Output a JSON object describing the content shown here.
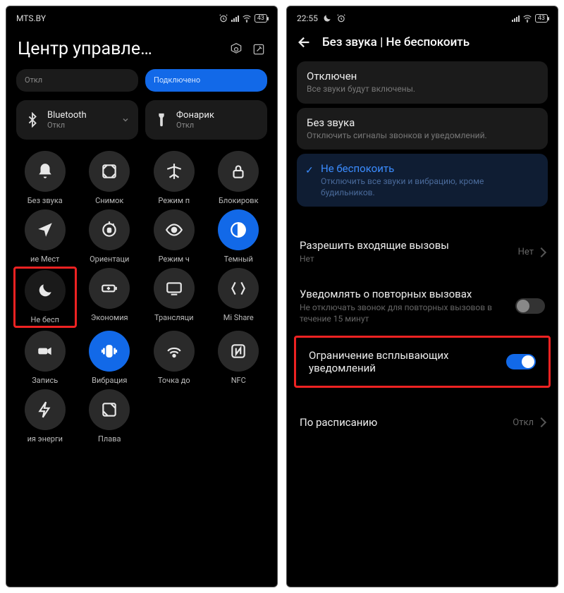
{
  "left": {
    "status": {
      "carrier": "MTS.BY",
      "battery": "43"
    },
    "header_title": "Центр управле…",
    "top_tiles": {
      "off_sub": "Откл",
      "connected_sub": "Подключено"
    },
    "wide_tiles": [
      {
        "label": "Bluetooth",
        "sub": "Откл"
      },
      {
        "label": "Фонарик",
        "sub": "Откл"
      }
    ],
    "grid_row1": [
      {
        "label": "Без звука"
      },
      {
        "label": "Снимок"
      },
      {
        "label": "Режим п"
      },
      {
        "label": "Блокировк"
      }
    ],
    "grid_row2": [
      {
        "label": "ие   Мест"
      },
      {
        "label": "Ориентаци"
      },
      {
        "label": "Режим ч"
      },
      {
        "label": "Темный"
      }
    ],
    "grid_row3": [
      {
        "label": "Не бесп"
      },
      {
        "label": "Экономия"
      },
      {
        "label": "Трансляци"
      },
      {
        "label": "Mi Share"
      }
    ],
    "grid_row4": [
      {
        "label": "Запись"
      },
      {
        "label": "Вибрация"
      },
      {
        "label": "Точка до"
      },
      {
        "label": "NFC"
      }
    ],
    "grid_row5": [
      {
        "label": "ия энерги"
      },
      {
        "label": "Плава"
      }
    ]
  },
  "right": {
    "status": {
      "time": "22:55",
      "battery": "43"
    },
    "page_title": "Без звука | Не беспокоить",
    "options": [
      {
        "title": "Отключен",
        "sub": "Все звуки будут включены."
      },
      {
        "title": "Без звука",
        "sub": "Отключить сигналы звонков и уведомлений."
      },
      {
        "title": "Не беспокоить",
        "sub": "Отключить все звуки и вибрацию, кроме будильников."
      }
    ],
    "rows": {
      "allow_calls": {
        "title": "Разрешить входящие вызовы",
        "sub": "Нет",
        "value": "Нет"
      },
      "repeat_calls": {
        "title": "Уведомлять о повторных вызовах",
        "sub": "Не отключать звонок для повторных вызовов в течение 15 минут"
      },
      "limit_popup": {
        "title": "Ограничение всплывающих уведомлений"
      },
      "schedule": {
        "title": "По расписанию",
        "value": "Откл"
      }
    }
  }
}
